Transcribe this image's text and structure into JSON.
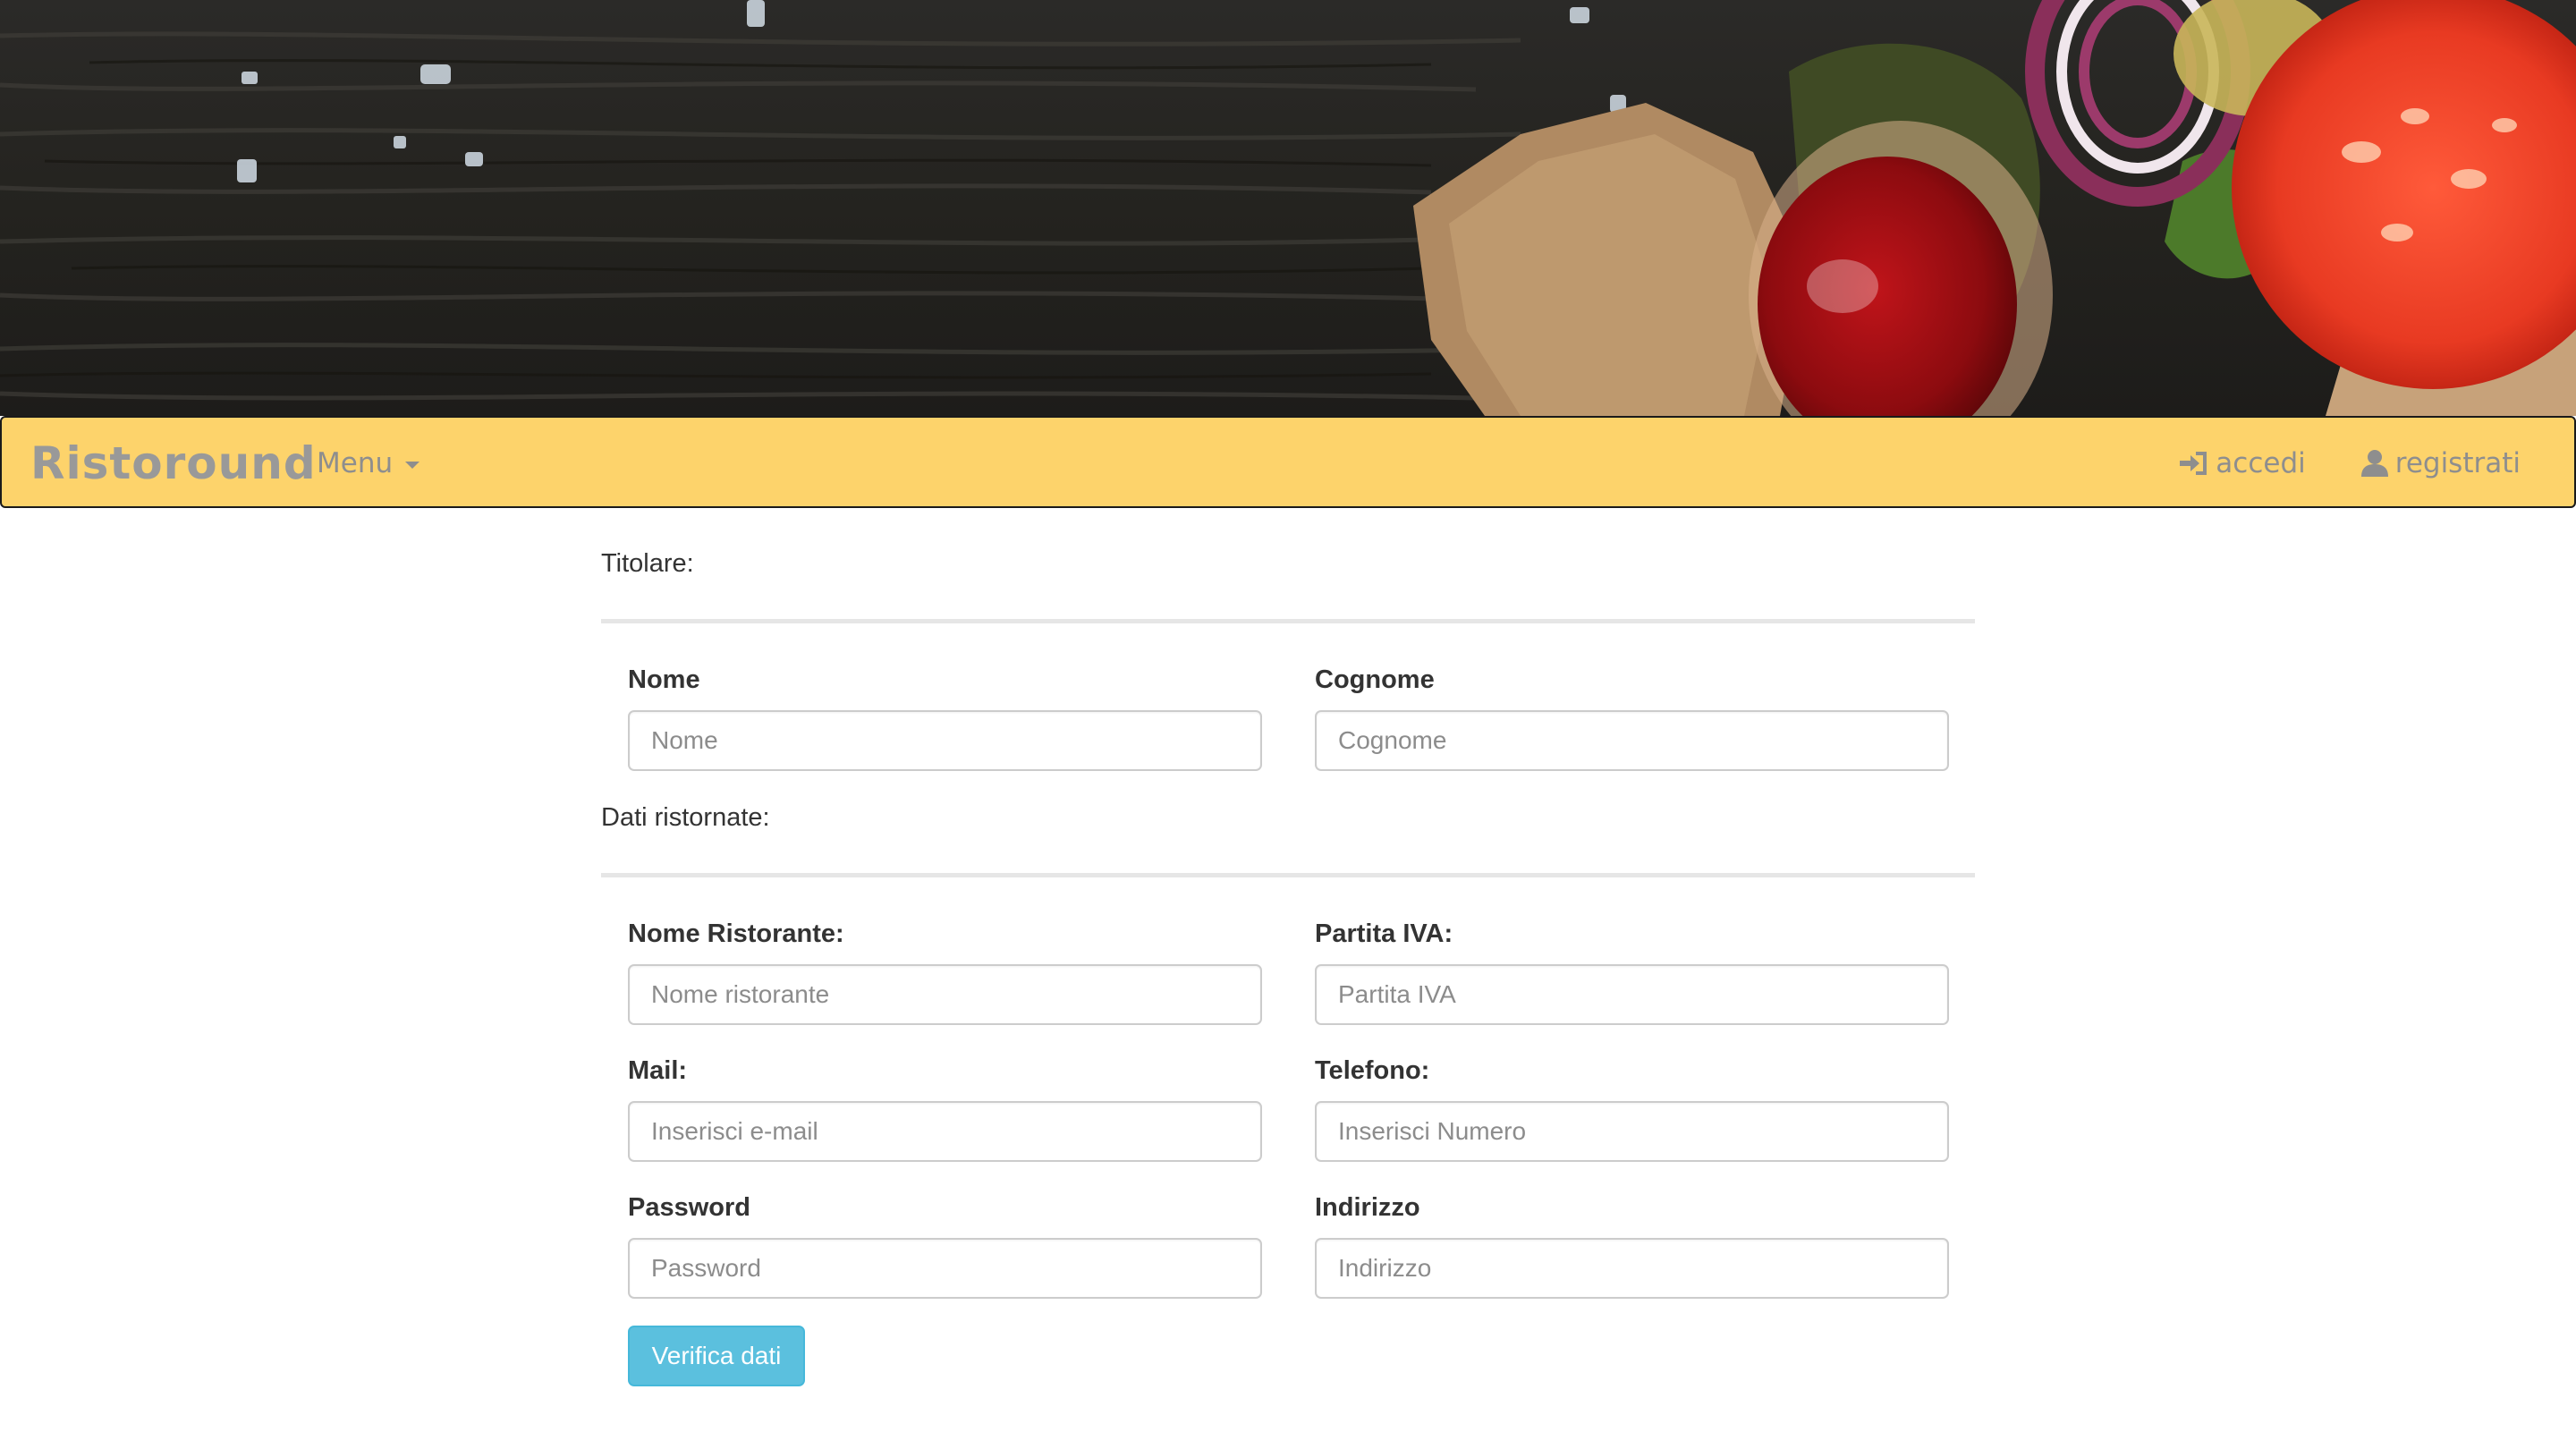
{
  "navbar": {
    "brand": "Ristoround",
    "menu_label": "Menu",
    "login_label": "accedi",
    "register_label": "registrati"
  },
  "sections": {
    "owner_title": "Titolare:",
    "restaurant_title": "Dati ristornate:"
  },
  "fields": {
    "nome": {
      "label": "Nome",
      "placeholder": "Nome",
      "value": ""
    },
    "cognome": {
      "label": "Cognome",
      "placeholder": "Cognome",
      "value": ""
    },
    "nome_ristorante": {
      "label": "Nome Ristorante:",
      "placeholder": "Nome ristorante",
      "value": ""
    },
    "partita_iva": {
      "label": "Partita IVA:",
      "placeholder": "Partita IVA",
      "value": ""
    },
    "mail": {
      "label": "Mail:",
      "placeholder": "Inserisci e-mail",
      "value": ""
    },
    "telefono": {
      "label": "Telefono:",
      "placeholder": "Inserisci Numero",
      "value": ""
    },
    "password": {
      "label": "Password",
      "placeholder": "Password",
      "value": ""
    },
    "indirizzo": {
      "label": "Indirizzo",
      "placeholder": "Indirizzo",
      "value": ""
    }
  },
  "actions": {
    "verify_label": "Verifica dati"
  },
  "icons": {
    "login": "log-in-icon",
    "register": "user-icon",
    "menu_caret": "caret-down-icon"
  },
  "colors": {
    "navbar_bg": "#fdd36b",
    "brand_text": "#999999",
    "button_info": "#5bc0de",
    "input_border": "#cccccc",
    "divider": "#e6e6e6"
  }
}
